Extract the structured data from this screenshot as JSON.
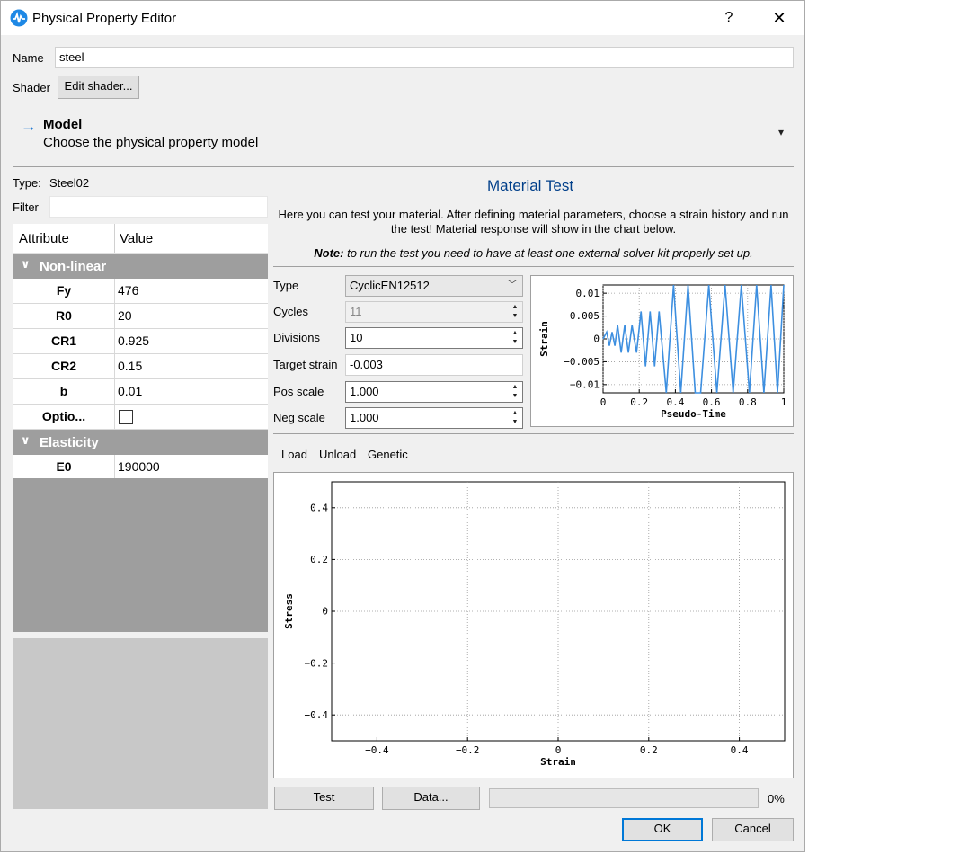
{
  "window": {
    "title": "Physical Property Editor",
    "help_label": "?",
    "close_label": "✕"
  },
  "name_label": "Name",
  "name_value": "steel",
  "shader_label": "Shader",
  "edit_shader_label": "Edit shader...",
  "model": {
    "arrow": "→",
    "title": "Model",
    "subtitle": "Choose the physical property model",
    "dropdown": "▾"
  },
  "type_label": "Type:",
  "type_value": "Steel02",
  "filter_label": "Filter",
  "filter_value": "",
  "table": {
    "col_attribute": "Attribute",
    "col_value": "Value",
    "groups": [
      {
        "name": "Non-linear",
        "rows": [
          {
            "key": "Fy",
            "value": "476"
          },
          {
            "key": "R0",
            "value": "20"
          },
          {
            "key": "CR1",
            "value": "0.925"
          },
          {
            "key": "CR2",
            "value": "0.15"
          },
          {
            "key": "b",
            "value": "0.01"
          },
          {
            "key": "Optio...",
            "checked": false
          }
        ]
      },
      {
        "name": "Elasticity",
        "rows": [
          {
            "key": "E0",
            "value": "190000"
          }
        ]
      }
    ]
  },
  "material_test": {
    "title": "Material Test",
    "intro_line1": "Here you can test your material. After defining material parameters, choose a strain history and run",
    "intro_line2": "the test! Material response will show in the chart below.",
    "note_bold": "Note:",
    "note_rest": " to run the test you need to have at least one external solver kit properly set up.",
    "params": {
      "type_label": "Type",
      "type_value": "CyclicEN12512",
      "cycles_label": "Cycles",
      "cycles_value": "11",
      "divisions_label": "Divisions",
      "divisions_value": "10",
      "target_label": "Target strain",
      "target_value": "-0.003",
      "pos_label": "Pos scale",
      "pos_value": "1.000",
      "neg_label": "Neg scale",
      "neg_value": "1.000"
    },
    "tabs": [
      "Load",
      "Unload",
      "Genetic"
    ],
    "test_label": "Test",
    "data_label": "Data...",
    "progress_text": "0%",
    "progress_value": 0
  },
  "ok_label": "OK",
  "cancel_label": "Cancel",
  "colors": {
    "accent": "#0078d7",
    "title_blue": "#003f8a",
    "line_blue": "#3d8fe0"
  },
  "chart_data": [
    {
      "type": "line",
      "title": "",
      "xlabel": "Pseudo-Time",
      "ylabel": "Strain",
      "xlim": [
        0,
        1
      ],
      "ylim": [
        -0.0118,
        0.0118
      ],
      "x_ticks": [
        "0",
        "0.2",
        "0.4",
        "0.6",
        "0.8",
        "1"
      ],
      "y_ticks": [
        "0.01",
        "0.005",
        "0",
        "−0.005",
        "−0.01"
      ],
      "y_tick_values": [
        0.01,
        0.005,
        0,
        -0.005,
        -0.01
      ],
      "grid": true,
      "series": [
        {
          "x": [
            0,
            0.02,
            0.035,
            0.05,
            0.065,
            0.08,
            0.1,
            0.12,
            0.14,
            0.16,
            0.185,
            0.21,
            0.235,
            0.26,
            0.285,
            0.31,
            0.35,
            0.39,
            0.43,
            0.47,
            0.51,
            0.54,
            0.585,
            0.63,
            0.675,
            0.72,
            0.765,
            0.81,
            0.85,
            0.89,
            0.93,
            0.965,
            1.0
          ],
          "y": [
            0,
            0.0015,
            -0.0015,
            0.0015,
            -0.0015,
            0.003,
            -0.003,
            0.003,
            -0.003,
            0.003,
            -0.003,
            0.006,
            -0.006,
            0.006,
            -0.006,
            0.006,
            -0.012,
            0.012,
            -0.012,
            0.012,
            -0.012,
            -0.012,
            0.012,
            -0.012,
            0.012,
            -0.012,
            0.012,
            -0.012,
            0.012,
            -0.012,
            0.012,
            -0.012,
            0.012
          ]
        }
      ]
    },
    {
      "type": "scatter",
      "title": "",
      "xlabel": "Strain",
      "ylabel": "Stress",
      "xlim": [
        -0.5,
        0.5
      ],
      "ylim": [
        -0.5,
        0.5
      ],
      "x_ticks": [
        "−0.4",
        "−0.2",
        "0",
        "0.2",
        "0.4"
      ],
      "x_tick_values": [
        -0.4,
        -0.2,
        0,
        0.2,
        0.4
      ],
      "y_ticks": [
        "0.4",
        "0.2",
        "0",
        "−0.2",
        "−0.4"
      ],
      "y_tick_values": [
        0.4,
        0.2,
        0,
        -0.2,
        -0.4
      ],
      "grid": true,
      "series": []
    }
  ]
}
